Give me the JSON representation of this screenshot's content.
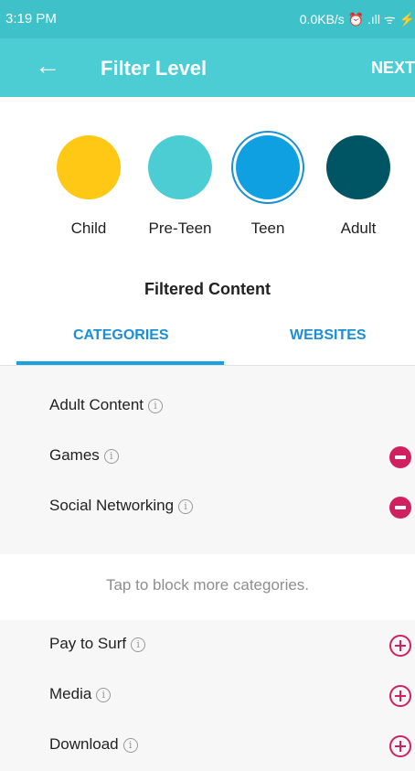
{
  "status_bar": {
    "time": "3:19 PM",
    "right": "0.0KB/s ⏰ .ıll ᯤ ⚡"
  },
  "app_bar": {
    "back_icon": "←",
    "title": "Filter Level",
    "next_label": "NEXT"
  },
  "levels": [
    {
      "label": "Child",
      "color": "#ffc814"
    },
    {
      "label": "Pre-Teen",
      "color": "#4ccdd4"
    },
    {
      "label": "Teen",
      "color": "#0fa0e2",
      "selected": true
    },
    {
      "label": "Adult",
      "color": "#005565"
    }
  ],
  "filtered": {
    "title": "Filtered Content",
    "tabs": [
      "CATEGORIES",
      "WEBSITES"
    ],
    "active_tab": "CATEGORIES"
  },
  "blocked_categories": [
    {
      "name": "Adult Content",
      "removable": false
    },
    {
      "name": "Games",
      "removable": true
    },
    {
      "name": "Social Networking",
      "removable": true
    }
  ],
  "hint": "Tap to block more categories.",
  "available_categories": [
    {
      "name": "Pay to Surf"
    },
    {
      "name": "Media"
    },
    {
      "name": "Download"
    }
  ],
  "colors": {
    "accent_teal": "#4ccdd4",
    "tab_blue": "#1a8fd6",
    "action_pink": "#d1205f"
  }
}
